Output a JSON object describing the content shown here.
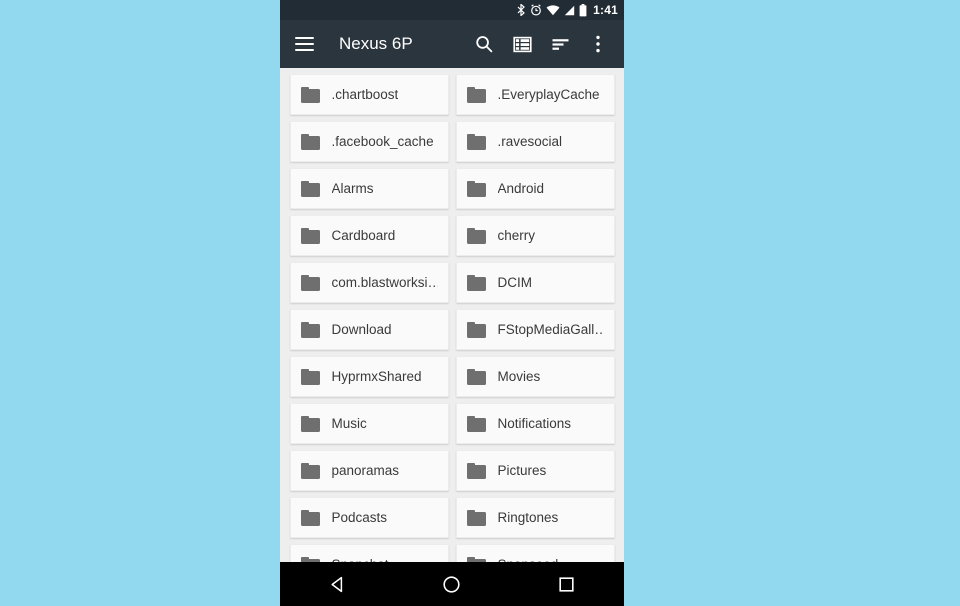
{
  "status_bar": {
    "icons": [
      "bluetooth-icon",
      "alarm-icon",
      "wifi-icon",
      "signal-icon",
      "battery-icon"
    ],
    "time": "1:41"
  },
  "app_bar": {
    "menu_icon": "hamburger-icon",
    "title": "Nexus 6P",
    "actions": [
      {
        "name": "search-icon",
        "label": "Search"
      },
      {
        "name": "view-list-icon",
        "label": "View"
      },
      {
        "name": "sort-icon",
        "label": "Sort"
      },
      {
        "name": "overflow-menu-icon",
        "label": "More options"
      }
    ]
  },
  "file_grid": {
    "items": [
      {
        "name": ".chartboost",
        "type": "folder"
      },
      {
        "name": ".EveryplayCache",
        "type": "folder"
      },
      {
        "name": ".facebook_cache",
        "type": "folder"
      },
      {
        "name": ".ravesocial",
        "type": "folder"
      },
      {
        "name": "Alarms",
        "type": "folder"
      },
      {
        "name": "Android",
        "type": "folder"
      },
      {
        "name": "Cardboard",
        "type": "folder"
      },
      {
        "name": "cherry",
        "type": "folder"
      },
      {
        "name": "com.blastworksi…",
        "type": "folder"
      },
      {
        "name": "DCIM",
        "type": "folder"
      },
      {
        "name": "Download",
        "type": "folder"
      },
      {
        "name": "FStopMediaGall…",
        "type": "folder"
      },
      {
        "name": "HyprmxShared",
        "type": "folder"
      },
      {
        "name": "Movies",
        "type": "folder"
      },
      {
        "name": "Music",
        "type": "folder"
      },
      {
        "name": "Notifications",
        "type": "folder"
      },
      {
        "name": "panoramas",
        "type": "folder"
      },
      {
        "name": "Pictures",
        "type": "folder"
      },
      {
        "name": "Podcasts",
        "type": "folder"
      },
      {
        "name": "Ringtones",
        "type": "folder"
      },
      {
        "name": "Snapchat",
        "type": "folder"
      },
      {
        "name": "Snapseed",
        "type": "folder"
      }
    ]
  },
  "nav_bar": {
    "buttons": [
      {
        "name": "back-icon",
        "label": "Back"
      },
      {
        "name": "home-icon",
        "label": "Home"
      },
      {
        "name": "recents-icon",
        "label": "Recents"
      }
    ]
  },
  "colors": {
    "background": "#92d8ee",
    "app_bar": "#2b353e",
    "status_bar": "#222c34",
    "surface": "#fafafa",
    "grid_background": "#eeeeee",
    "folder_icon": "#6f6f6f",
    "nav_bar": "#000000"
  }
}
